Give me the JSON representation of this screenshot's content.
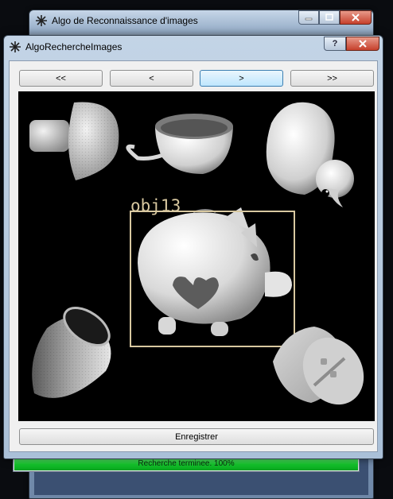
{
  "background_window": {
    "title": "Algo de Reconnaissance d'images",
    "status_text": "Recherche terminee. 100%",
    "progress": 100
  },
  "dialog": {
    "title": "AlgoRechercheImages",
    "nav": {
      "first": "<<",
      "prev": "<",
      "next": ">",
      "last": ">>"
    },
    "save_label": "Enregistrer",
    "image": {
      "detection": {
        "label": "obj13",
        "box_color": "#d8c8a0"
      },
      "objects": [
        "mushroom",
        "cup",
        "duck",
        "piggy-bank",
        "paper-cup",
        "bottle-cap"
      ]
    }
  },
  "colors": {
    "progress_green": "#13c42b",
    "focus_blue": "#3c7fb1",
    "close_red": "#c6402c"
  }
}
